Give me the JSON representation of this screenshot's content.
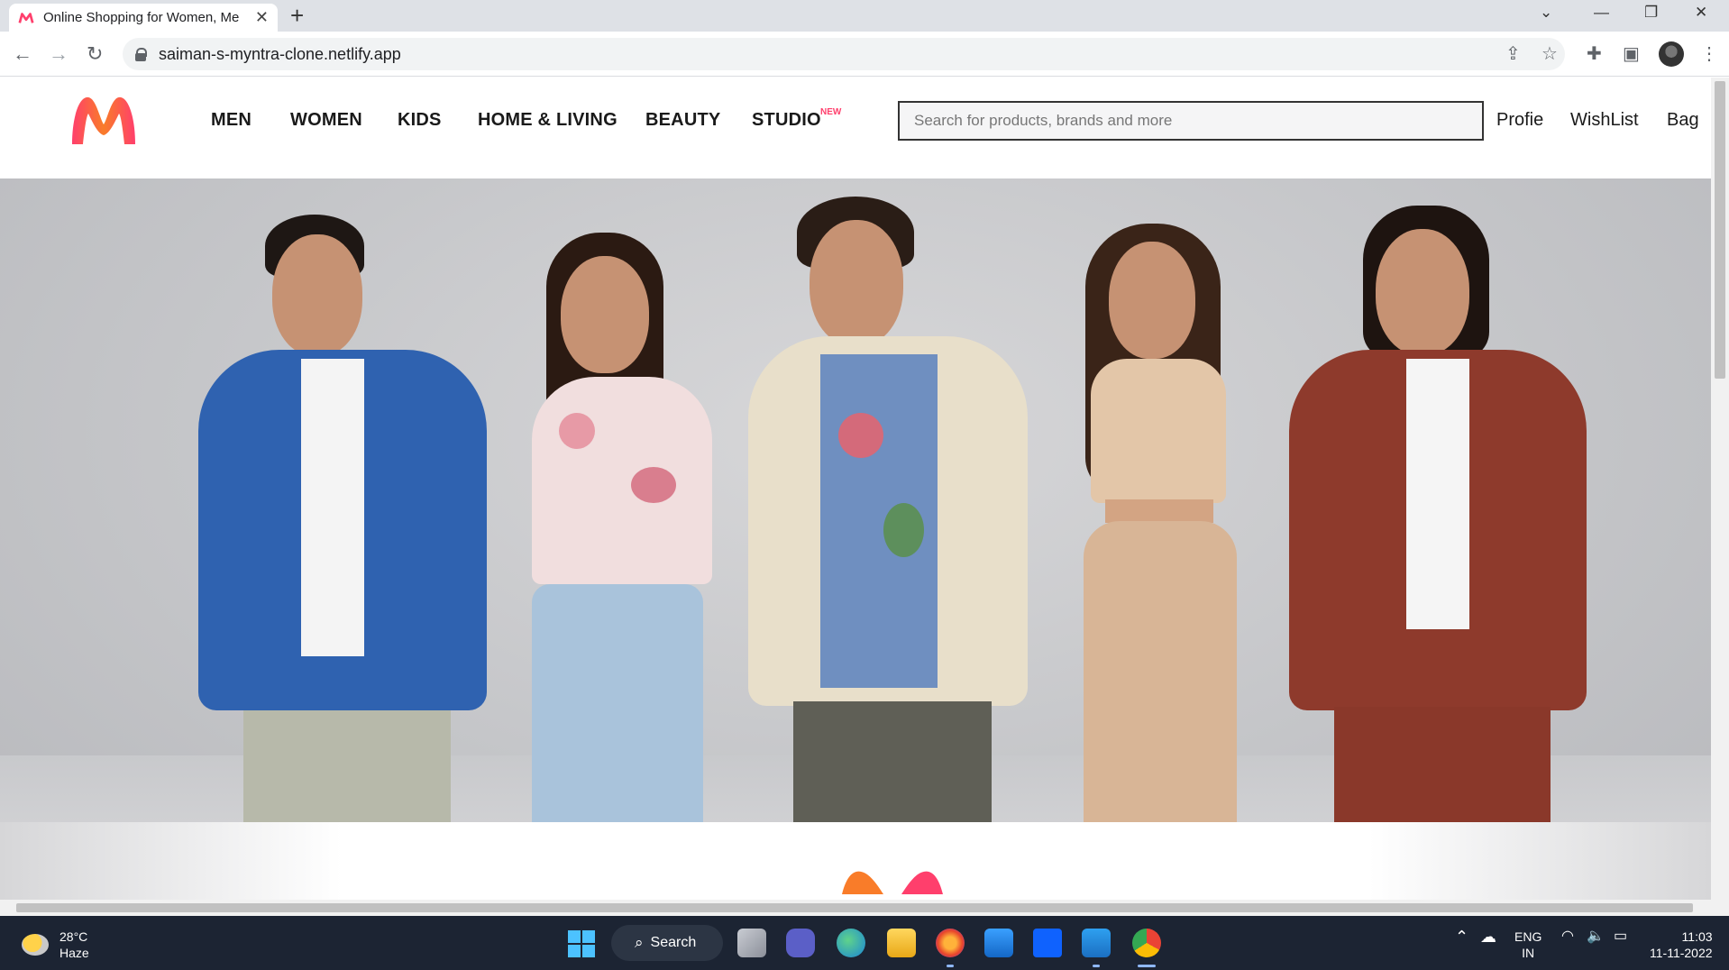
{
  "browser": {
    "tab_title": "Online Shopping for Women, Me",
    "url": "saiman-s-myntra-clone.netlify.app"
  },
  "header": {
    "nav": [
      "MEN",
      "WOMEN",
      "KIDS",
      "HOME & LIVING",
      "BEAUTY",
      "STUDIO"
    ],
    "new_badge": "NEW",
    "search_placeholder": "Search for products, brands and more",
    "links": [
      "Profie",
      "WishList",
      "Bag"
    ]
  },
  "colors": {
    "brand_pink": "#ff3f6c",
    "brand_orange": "#f97c29"
  },
  "taskbar": {
    "temperature": "28°C",
    "weather": "Haze",
    "search_label": "Search",
    "lang_1": "ENG",
    "lang_2": "IN",
    "time": "11:03",
    "date": "11-11-2022"
  }
}
